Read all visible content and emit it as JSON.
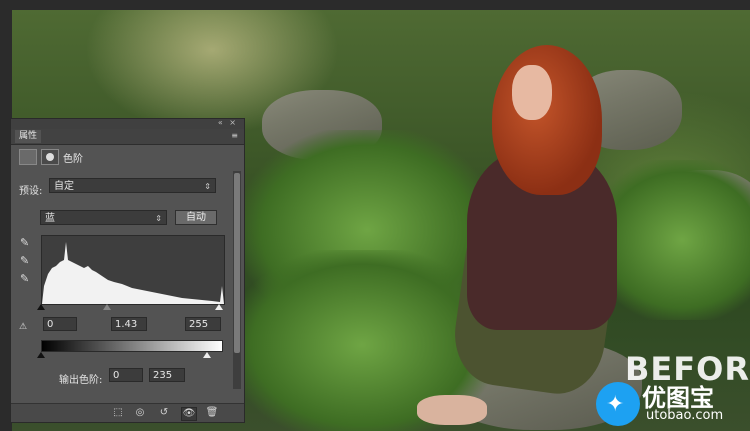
{
  "panel": {
    "tab_label": "属性",
    "adjustment_title": "色阶",
    "preset_label": "预设:",
    "preset_value": "自定",
    "channel_value": "蓝",
    "auto_label": "自动",
    "input_black": "0",
    "input_gamma": "1.43",
    "input_white": "255",
    "output_label": "输出色阶:",
    "output_black": "0",
    "output_white": "235"
  },
  "overlay": {
    "before_text": "BEFORE",
    "logo_title": "优图宝",
    "logo_sub": "utobao.com"
  },
  "icons": {
    "collapse": "«",
    "close": "×",
    "menu": "≡",
    "select_arrow": "⇕",
    "eyedropper": "✎",
    "clip_to_layer": "⬚",
    "view_previous": "◎",
    "reset": "↺",
    "visibility": "👁",
    "delete": "🗑"
  }
}
